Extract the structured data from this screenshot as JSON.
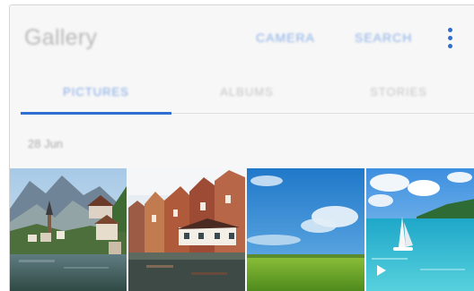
{
  "appbar": {
    "title": "Gallery",
    "actions": {
      "camera": "CAMERA",
      "search": "SEARCH"
    },
    "more_icon": "more-vertical-icon"
  },
  "tabs": [
    {
      "label": "PICTURES",
      "selected": true
    },
    {
      "label": "ALBUMS",
      "selected": false
    },
    {
      "label": "STORIES",
      "selected": false
    }
  ],
  "section": {
    "date": "28 Jun"
  },
  "thumbnails": [
    {
      "subject": "mountain-lake-village"
    },
    {
      "subject": "canal-houses"
    },
    {
      "subject": "field-and-sky"
    },
    {
      "subject": "sailboat-lagoon",
      "video_icon": "play-icon"
    }
  ],
  "colors": {
    "accent": "#2e6fd1",
    "background": "#f7f7f7"
  }
}
